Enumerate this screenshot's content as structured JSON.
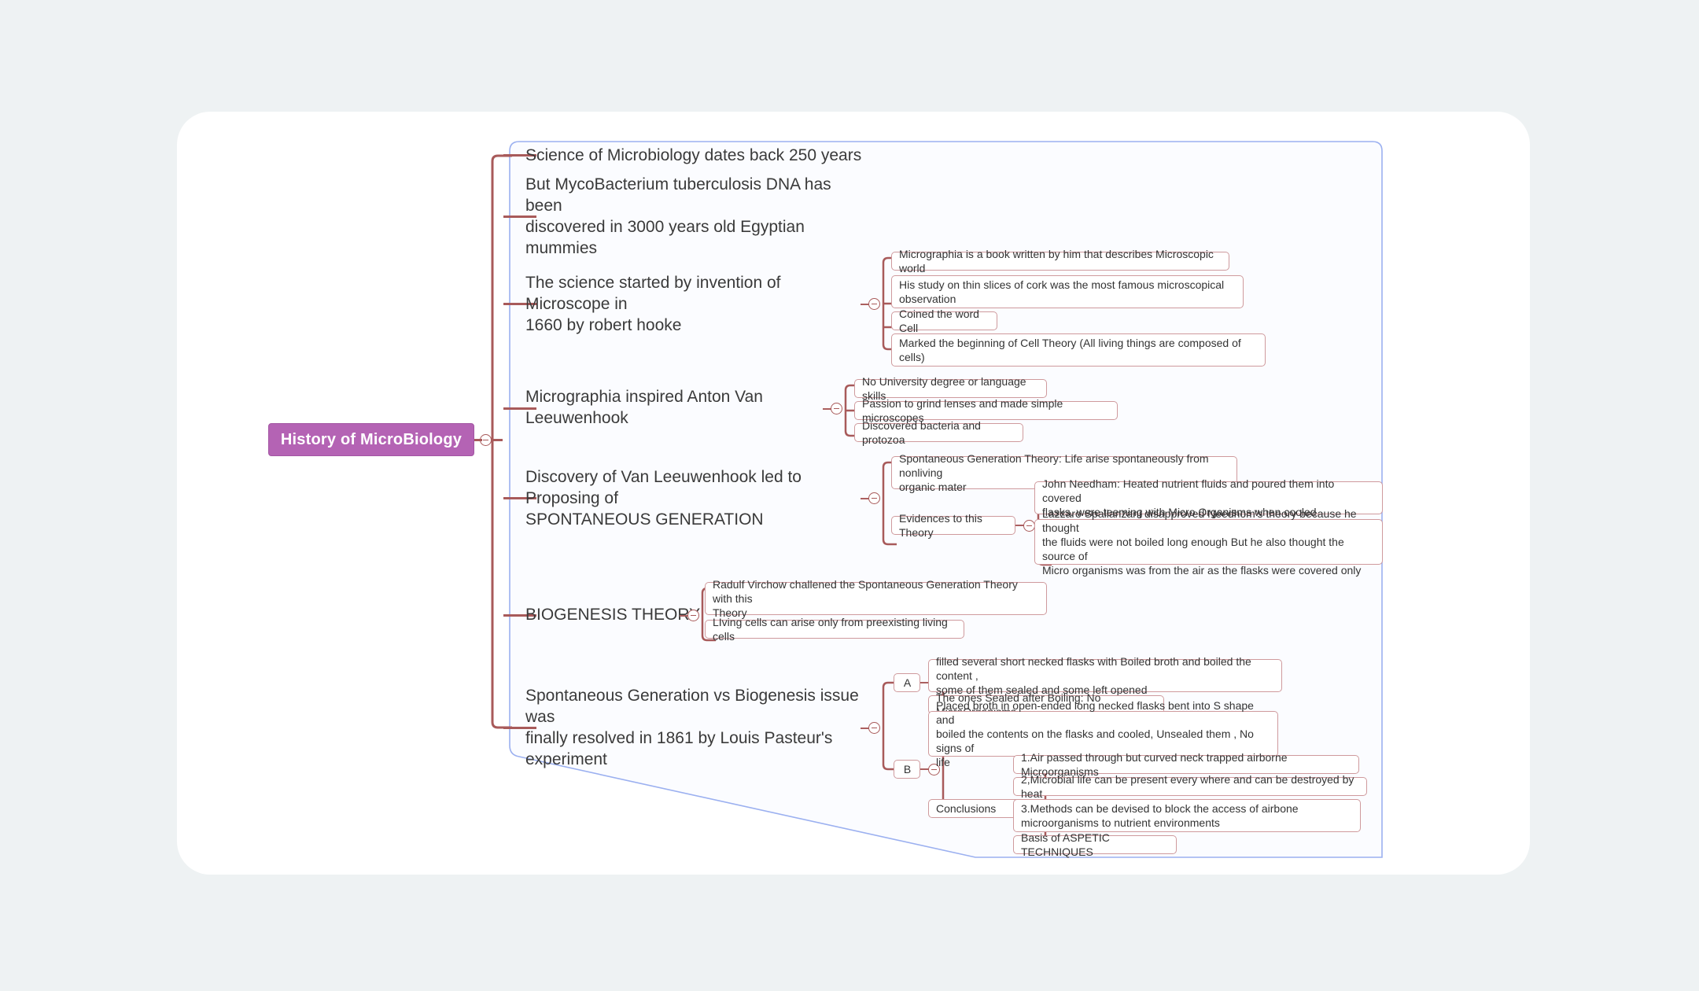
{
  "page": {
    "background_color": "#eef2f3",
    "card_color": "#ffffff",
    "canvas_border_color": "#9bb0f0",
    "branch_line_color": "#a85a5a",
    "node_border_color": "#cf9a9d",
    "root_fill_color": "#b463b4",
    "text_color": "#333333"
  },
  "mindmap": {
    "root": {
      "label": "History of MicroBiology",
      "toggle": "collapse-toggle"
    },
    "branches": [
      {
        "id": "b1",
        "label": "Science of Microbiology dates back 250 years",
        "children": []
      },
      {
        "id": "b2",
        "label": "But MycoBacterium tuberculosis DNA has been\ndiscovered in 3000 years old Egyptian mummies",
        "children": []
      },
      {
        "id": "b3",
        "label": "The science started by invention of Microscope in\n1660 by robert hooke",
        "children": [
          {
            "id": "b3c1",
            "label": "Micrographia is a book written by him that describes Microscopic world"
          },
          {
            "id": "b3c2",
            "label": "His study on thin slices of cork was the most famous microscopical\nobservation"
          },
          {
            "id": "b3c3",
            "label": "Coined the word Cell"
          },
          {
            "id": "b3c4",
            "label": "Marked the beginning of Cell Theory (All living things are composed of\ncells)"
          }
        ]
      },
      {
        "id": "b4",
        "label": "Micrographia inspired Anton Van Leeuwenhook",
        "children": [
          {
            "id": "b4c1",
            "label": "No University degree or language skills"
          },
          {
            "id": "b4c2",
            "label": "Passion to grind lenses and made simple microscopes"
          },
          {
            "id": "b4c3",
            "label": "Discovered bacteria and protozoa"
          }
        ]
      },
      {
        "id": "b5",
        "label": "Discovery of Van Leeuwenhook led to Proposing of\nSPONTANEOUS GENERATION",
        "children": [
          {
            "id": "b5c1",
            "label": "Spontaneous Generation Theory: Life arise spontaneously from nonliving\norganic mater"
          },
          {
            "id": "b5c2",
            "label": "Evidences to this Theory",
            "children": [
              {
                "id": "b5c2g1",
                "label": "John Needham: Heated nutrient fluids and poured them into covered\nflasks. were teeming with Micro Organisms when cooled"
              },
              {
                "id": "b5c2g2",
                "label": "Lazzaro Spallanzani disapproved Needhom's theory because he thought\nthe fluids were not boiled long enough But he also thought the source of\nMicro organisms was from the air as the flasks were covered only"
              }
            ]
          }
        ]
      },
      {
        "id": "b6",
        "label": "BIOGENESIS THEORY",
        "children": [
          {
            "id": "b6c1",
            "label": "Radulf Virchow challened the Spontaneous Generation Theory with this\nTheory"
          },
          {
            "id": "b6c2",
            "label": "LIving cells can arise only from preexisting living cells"
          }
        ]
      },
      {
        "id": "b7",
        "label": "Spontaneous Generation vs Biogenesis issue was\nfinally resolved in 1861 by Louis Pasteur's experiment",
        "children": [
          {
            "id": "b7cA",
            "label": "A",
            "children": [
              {
                "id": "b7cAg1",
                "label": "filled several short necked flasks with Boiled broth and boiled the content ,\nsome of them sealed and some left opened"
              },
              {
                "id": "b7cAg2",
                "label": "The ones Sealed after Boiling: No MicroOrganisms"
              }
            ]
          },
          {
            "id": "b7cB",
            "label": "B",
            "children": [
              {
                "id": "b7cBg1",
                "label": "Placed broth in open-ended long necked flasks bent into S shape and\nboiled the contents on the flasks and cooled, Unsealed them , No signs of\nlife"
              },
              {
                "id": "b7cBg2",
                "label": "Conclusions",
                "children": [
                  {
                    "id": "b7cBg2h1",
                    "label": "1.Air passed through but curved neck trapped airborne Microorganisms"
                  },
                  {
                    "id": "b7cBg2h2",
                    "label": "2,Microbial life can be present every where and can be destroyed by heat"
                  },
                  {
                    "id": "b7cBg2h3",
                    "label": "3.Methods can be devised to block the access of airbone\nmicroorganisms to nutrient environments"
                  },
                  {
                    "id": "b7cBg2h4",
                    "label": "Basis of ASPETIC TECHNIQUES"
                  }
                ]
              }
            ]
          }
        ]
      }
    ]
  }
}
